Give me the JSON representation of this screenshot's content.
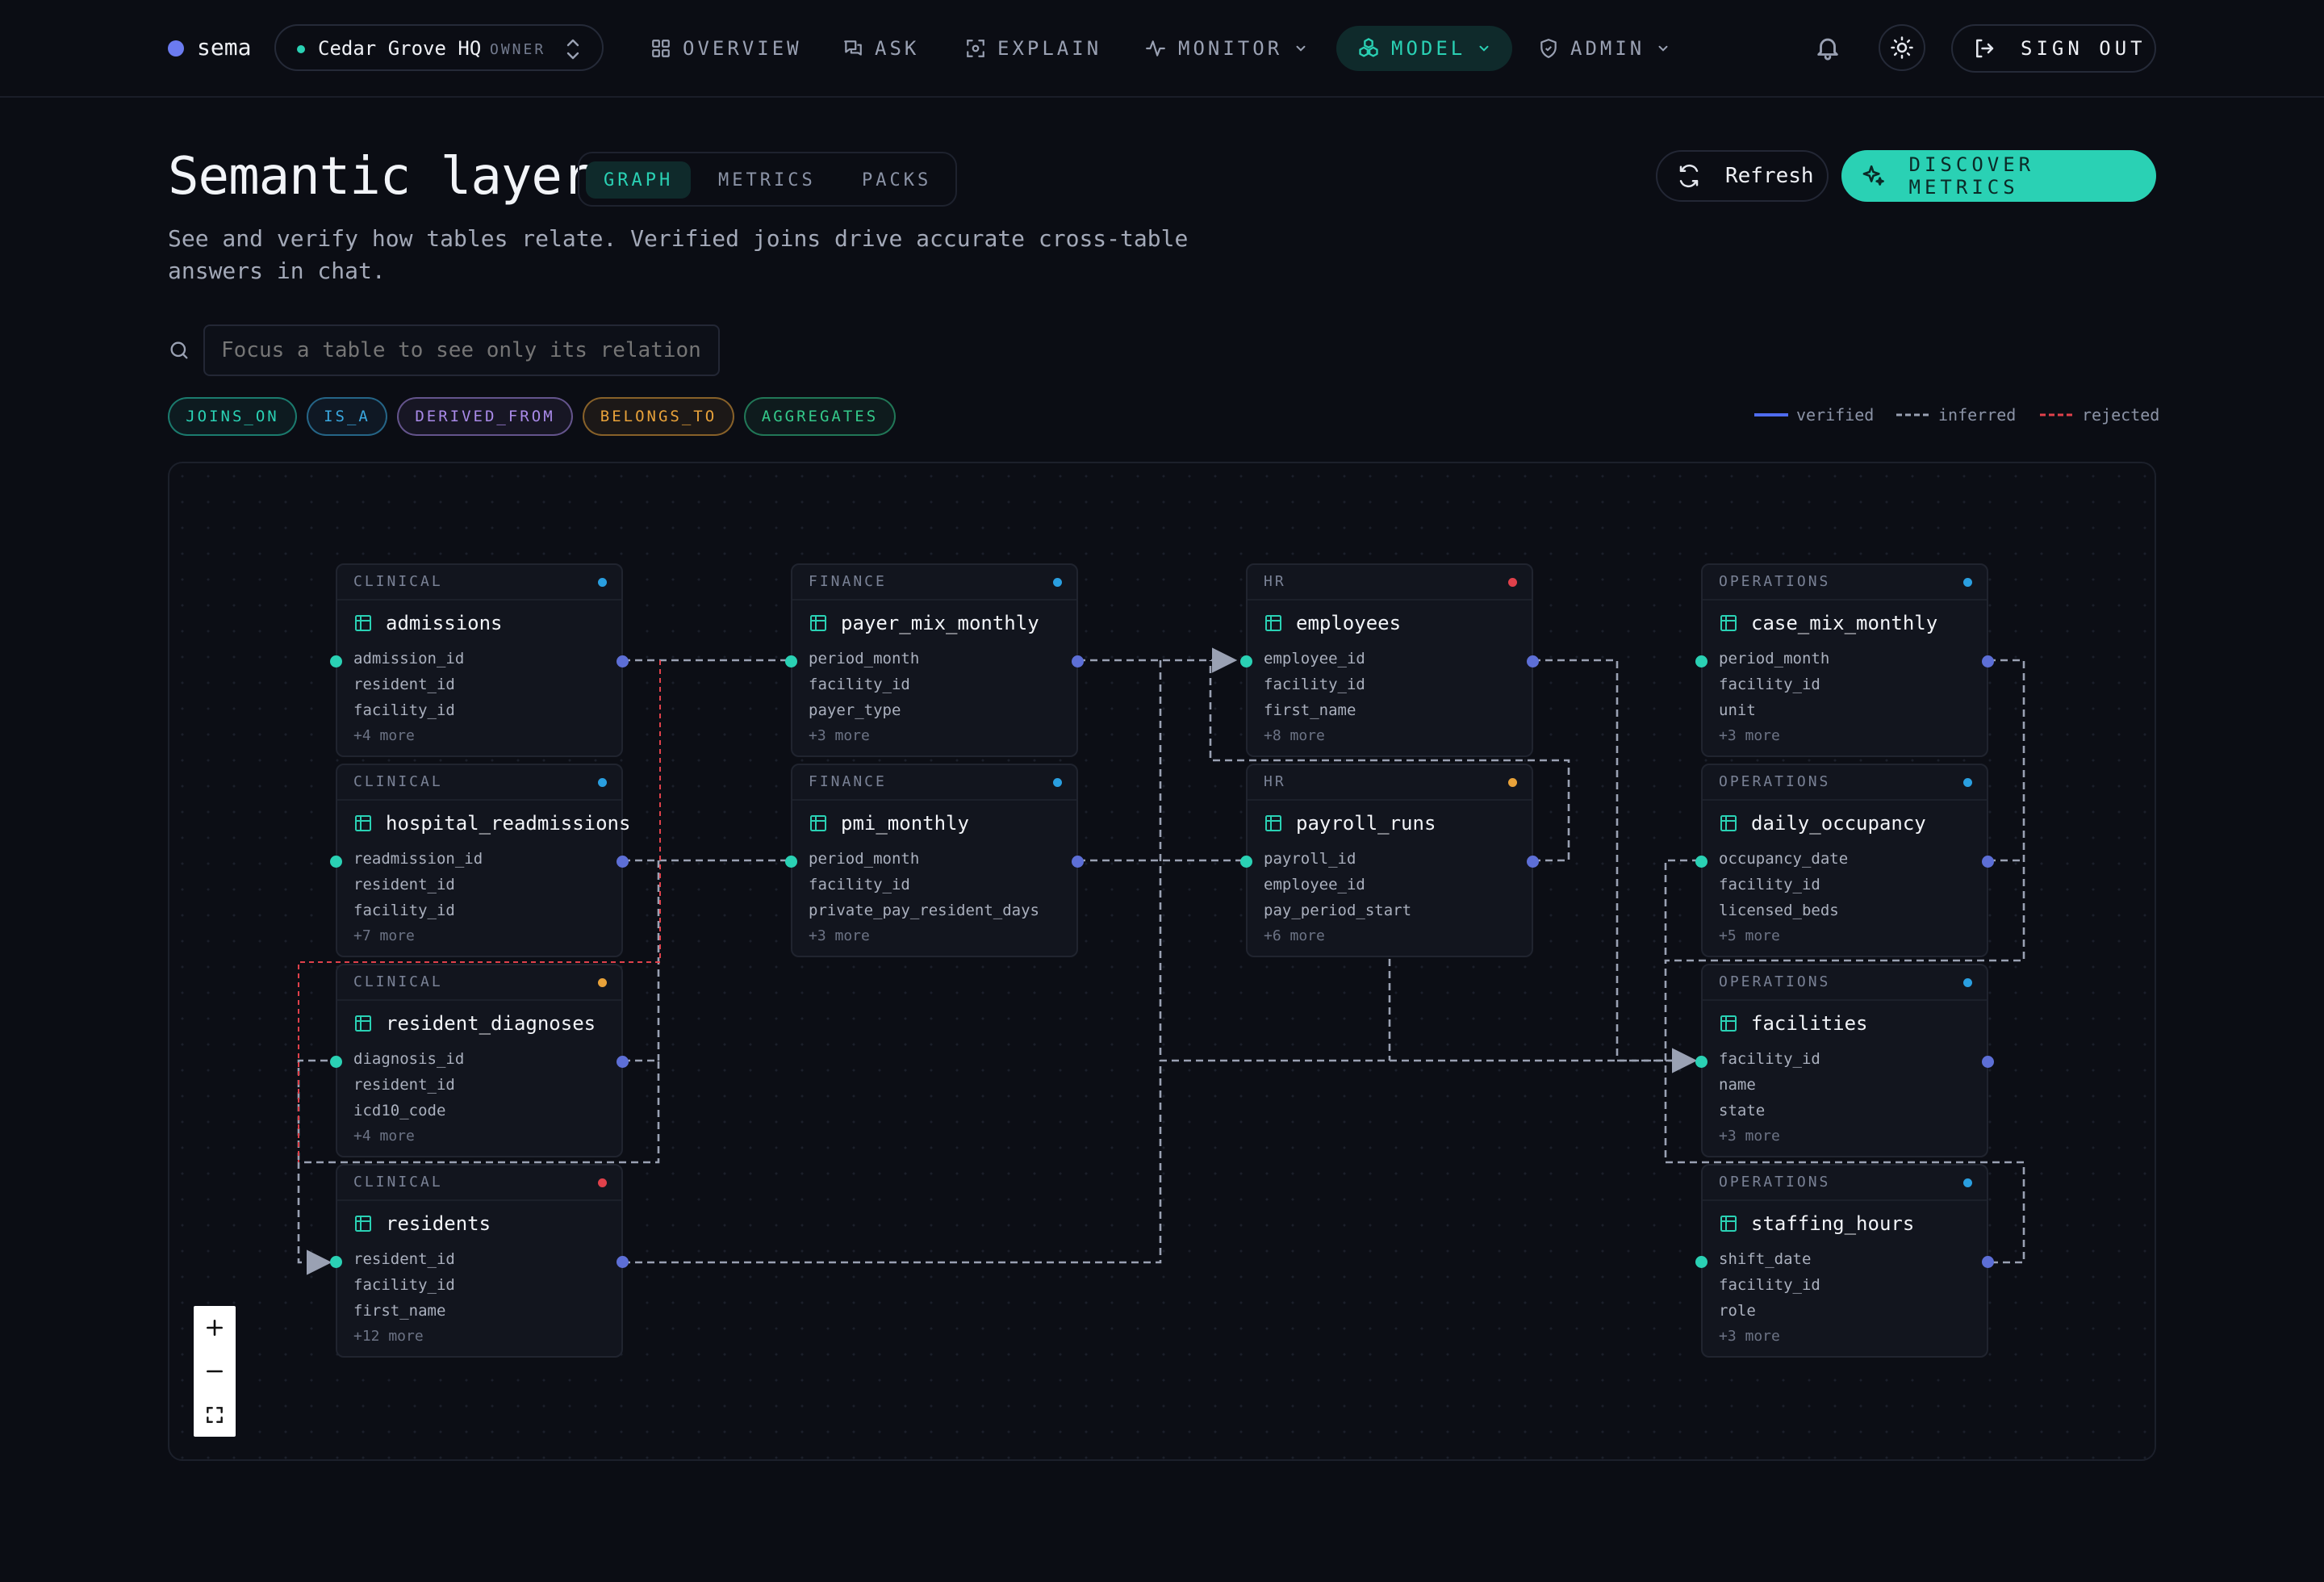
{
  "nav": {
    "brand": "sema",
    "workspace": {
      "name": "Cedar Grove HQ",
      "role": "OWNER"
    },
    "items": [
      {
        "label": "OVERVIEW",
        "icon": "grid-icon"
      },
      {
        "label": "ASK",
        "icon": "chat-icon"
      },
      {
        "label": "EXPLAIN",
        "icon": "scan-icon"
      },
      {
        "label": "MONITOR",
        "icon": "pulse-icon"
      },
      {
        "label": "MODEL",
        "icon": "cube-cluster-icon"
      },
      {
        "label": "ADMIN",
        "icon": "shield-icon"
      }
    ],
    "sign_out": "SIGN OUT"
  },
  "header": {
    "title": "Semantic layer",
    "tabs": [
      "GRAPH",
      "METRICS",
      "PACKS"
    ],
    "active_tab": "GRAPH",
    "subtitle": "See and verify how tables relate. Verified joins drive accurate cross-table answers in chat.",
    "refresh": "Refresh",
    "discover": "DISCOVER METRICS"
  },
  "search": {
    "placeholder": "Focus a table to see only its relationships"
  },
  "chips": [
    {
      "label": "JOINS_ON",
      "color": "#2ad1b4"
    },
    {
      "label": "IS_A",
      "color": "#3aa8e0"
    },
    {
      "label": "DERIVED_FROM",
      "color": "#a98ae8"
    },
    {
      "label": "BELONGS_TO",
      "color": "#e8a23a"
    },
    {
      "label": "AGGREGATES",
      "color": "#34c98a"
    }
  ],
  "legend": [
    {
      "label": "verified",
      "style": "solid",
      "color": "#4f6cf0"
    },
    {
      "label": "inferred",
      "style": "dashed",
      "color": "#9aa1b3"
    },
    {
      "label": "rejected",
      "style": "dashed",
      "color": "#e0414b"
    }
  ],
  "nodes": [
    {
      "category": "CLINICAL",
      "name": "admissions",
      "status": "#2a9fe0",
      "fields": [
        "admission_id",
        "resident_id",
        "facility_id"
      ],
      "more": "+4 more"
    },
    {
      "category": "CLINICAL",
      "name": "hospital_readmissions",
      "status": "#2a9fe0",
      "fields": [
        "readmission_id",
        "resident_id",
        "facility_id"
      ],
      "more": "+7 more"
    },
    {
      "category": "CLINICAL",
      "name": "resident_diagnoses",
      "status": "#e8a23a",
      "fields": [
        "diagnosis_id",
        "resident_id",
        "icd10_code"
      ],
      "more": "+4 more"
    },
    {
      "category": "CLINICAL",
      "name": "residents",
      "status": "#e0414b",
      "fields": [
        "resident_id",
        "facility_id",
        "first_name"
      ],
      "more": "+12 more"
    },
    {
      "category": "FINANCE",
      "name": "payer_mix_monthly",
      "status": "#2a9fe0",
      "fields": [
        "period_month",
        "facility_id",
        "payer_type"
      ],
      "more": "+3 more"
    },
    {
      "category": "FINANCE",
      "name": "pmi_monthly",
      "status": "#2a9fe0",
      "fields": [
        "period_month",
        "facility_id",
        "private_pay_resident_days"
      ],
      "more": "+3 more"
    },
    {
      "category": "HR",
      "name": "employees",
      "status": "#e0414b",
      "fields": [
        "employee_id",
        "facility_id",
        "first_name"
      ],
      "more": "+8 more"
    },
    {
      "category": "HR",
      "name": "payroll_runs",
      "status": "#e8a23a",
      "fields": [
        "payroll_id",
        "employee_id",
        "pay_period_start"
      ],
      "more": "+6 more"
    },
    {
      "category": "OPERATIONS",
      "name": "case_mix_monthly",
      "status": "#2a9fe0",
      "fields": [
        "period_month",
        "facility_id",
        "unit"
      ],
      "more": "+3 more"
    },
    {
      "category": "OPERATIONS",
      "name": "daily_occupancy",
      "status": "#2a9fe0",
      "fields": [
        "occupancy_date",
        "facility_id",
        "licensed_beds"
      ],
      "more": "+5 more"
    },
    {
      "category": "OPERATIONS",
      "name": "facilities",
      "status": "#2a9fe0",
      "fields": [
        "facility_id",
        "name",
        "state"
      ],
      "more": "+3 more"
    },
    {
      "category": "OPERATIONS",
      "name": "staffing_hours",
      "status": "#2a9fe0",
      "fields": [
        "shift_date",
        "facility_id",
        "role"
      ],
      "more": "+3 more"
    }
  ]
}
